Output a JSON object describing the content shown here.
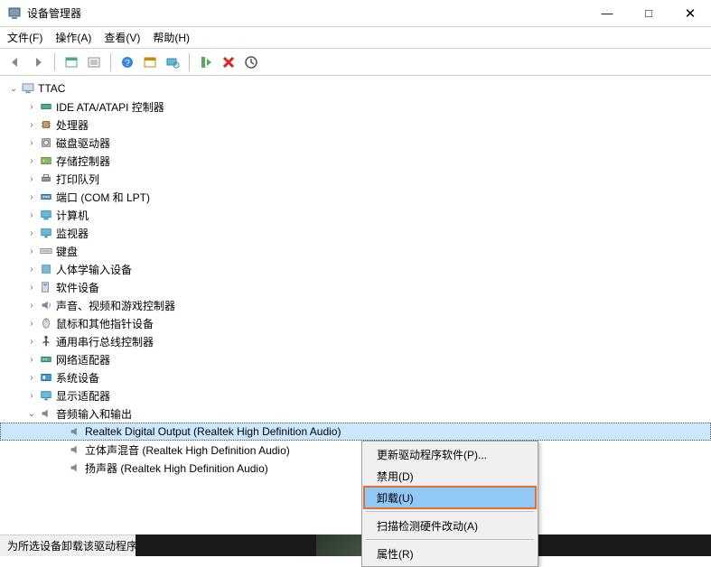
{
  "titlebar": {
    "title": "设备管理器"
  },
  "win_controls": {
    "minimize": "—",
    "maximize": "□",
    "close": "✕"
  },
  "menubar": {
    "file": "文件(F)",
    "action": "操作(A)",
    "view": "查看(V)",
    "help": "帮助(H)"
  },
  "root": {
    "label": "TTAC"
  },
  "categories": [
    {
      "label": "IDE ATA/ATAPI 控制器",
      "icon": "ide"
    },
    {
      "label": "处理器",
      "icon": "cpu"
    },
    {
      "label": "磁盘驱动器",
      "icon": "disk"
    },
    {
      "label": "存储控制器",
      "icon": "storage"
    },
    {
      "label": "打印队列",
      "icon": "printer"
    },
    {
      "label": "端口 (COM 和 LPT)",
      "icon": "port"
    },
    {
      "label": "计算机",
      "icon": "computer"
    },
    {
      "label": "监视器",
      "icon": "monitor"
    },
    {
      "label": "键盘",
      "icon": "keyboard"
    },
    {
      "label": "人体学输入设备",
      "icon": "hid"
    },
    {
      "label": "软件设备",
      "icon": "software"
    },
    {
      "label": "声音、视频和游戏控制器",
      "icon": "sound"
    },
    {
      "label": "鼠标和其他指针设备",
      "icon": "mouse"
    },
    {
      "label": "通用串行总线控制器",
      "icon": "usb"
    },
    {
      "label": "网络适配器",
      "icon": "network"
    },
    {
      "label": "系统设备",
      "icon": "system"
    },
    {
      "label": "显示适配器",
      "icon": "display"
    }
  ],
  "audio_category": {
    "label": "音频输入和输出",
    "icon": "speaker"
  },
  "audio_children": [
    {
      "label": "Realtek Digital Output (Realtek High Definition Audio)",
      "selected": true
    },
    {
      "label": "立体声混音 (Realtek High Definition Audio)",
      "selected": false
    },
    {
      "label": "扬声器 (Realtek High Definition Audio)",
      "selected": false
    }
  ],
  "context_menu": {
    "update": "更新驱动程序软件(P)...",
    "disable": "禁用(D)",
    "uninstall": "卸载(U)",
    "scan": "扫描检测硬件改动(A)",
    "properties": "属性(R)"
  },
  "statusbar": {
    "text": "为所选设备卸载该驱动程序。"
  }
}
